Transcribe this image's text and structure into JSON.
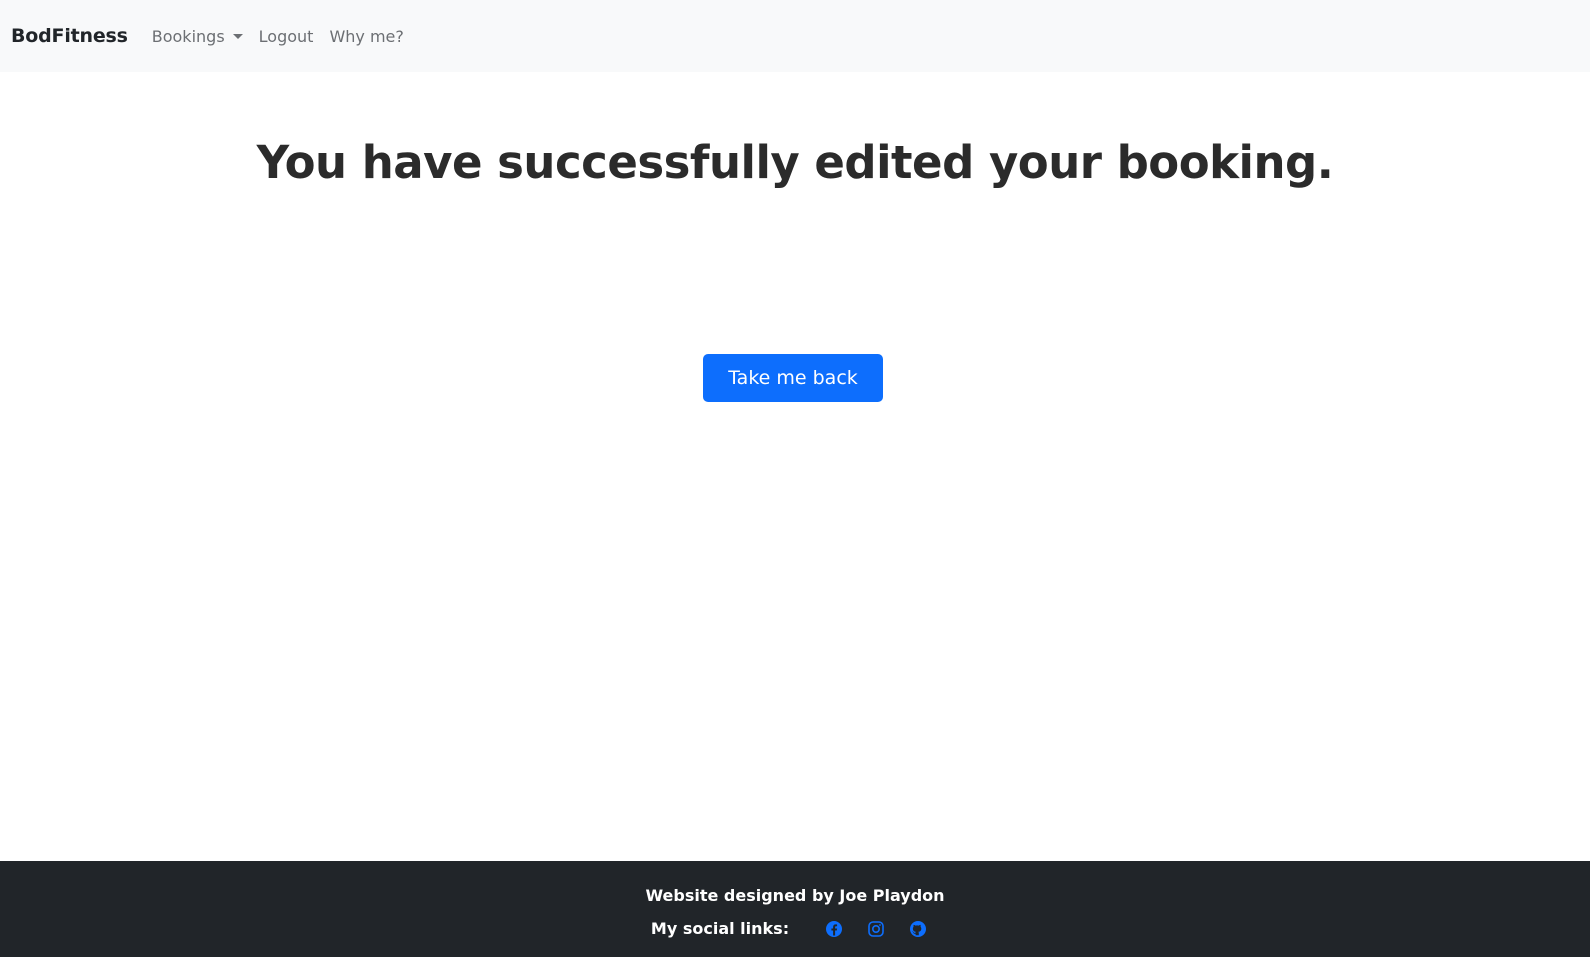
{
  "navbar": {
    "brand": "BodFitness",
    "links": [
      {
        "label": "Bookings",
        "dropdown": true
      },
      {
        "label": "Logout",
        "dropdown": false
      },
      {
        "label": "Why me?",
        "dropdown": false
      }
    ]
  },
  "main": {
    "headline": "You have successfully edited your booking.",
    "back_button_label": "Take me back"
  },
  "footer": {
    "credit": "Website designed by Joe Playdon",
    "social_label": "My social links:",
    "icons": [
      "facebook-icon",
      "instagram-icon",
      "github-icon"
    ]
  },
  "colors": {
    "navbar_bg": "#f8f9fa",
    "primary": "#0d6efd",
    "footer_bg": "#212529",
    "text_dark": "#212529",
    "nav_link": "#6c6f73"
  }
}
